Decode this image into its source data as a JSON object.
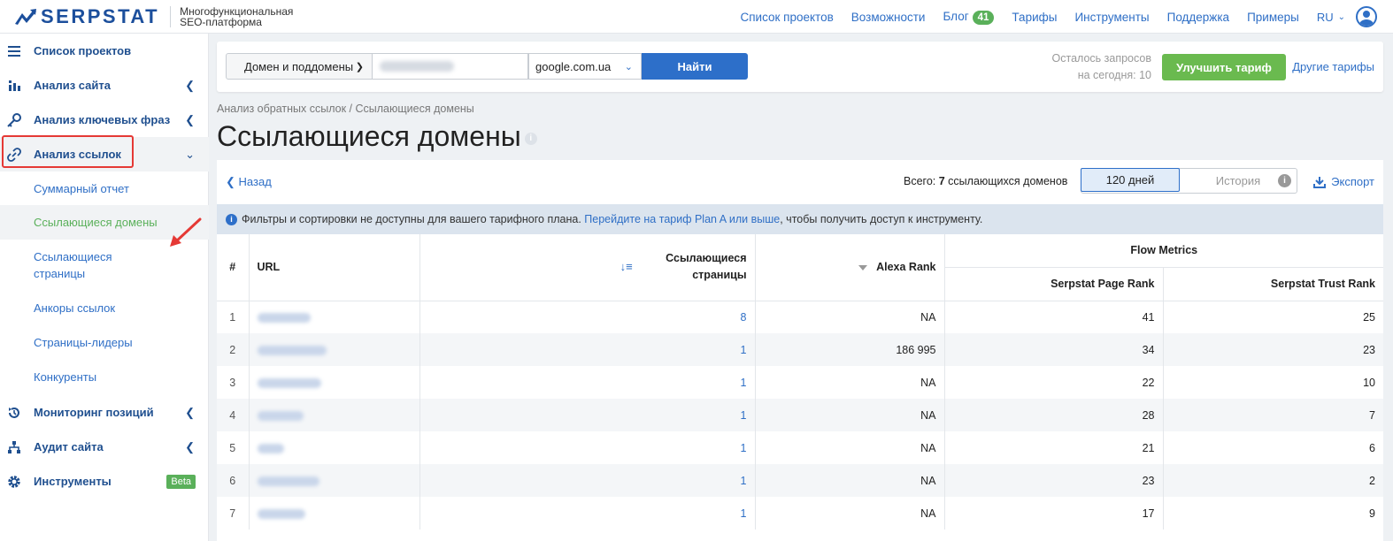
{
  "header": {
    "logo_text": "SERPSTAT",
    "logo_subtitle_1": "Многофункциональная",
    "logo_subtitle_2": "SEO-платформа",
    "nav": {
      "projects": "Список проектов",
      "features": "Возможности",
      "blog": "Блог",
      "blog_count": "41",
      "pricing": "Тарифы",
      "tools": "Инструменты",
      "support": "Поддержка",
      "examples": "Примеры"
    },
    "language": "RU"
  },
  "sidebar": {
    "items": {
      "projects": "Список проектов",
      "site_analysis": "Анализ сайта",
      "keyword_analysis": "Анализ ключевых фраз",
      "link_analysis": "Анализ ссылок",
      "position_monitoring": "Мониторинг позиций",
      "site_audit": "Аудит сайта",
      "tools": "Инструменты",
      "tools_badge": "Beta"
    },
    "sub_items": {
      "summary": "Суммарный отчет",
      "referring_domains": "Ссылающиеся домены",
      "referring_pages_1": "Ссылающиеся",
      "referring_pages_2": "страницы",
      "anchors": "Анкоры ссылок",
      "top_pages": "Страницы-лидеры",
      "competitors": "Конкуренты"
    }
  },
  "search": {
    "type_label": "Домен и поддомены",
    "database": "google.com.ua",
    "find_button": "Найти",
    "remaining_1": "Осталось запросов",
    "remaining_2": "на сегодня: 10",
    "upgrade_button": "Улучшить тариф",
    "other_tariffs": "Другие тарифы"
  },
  "page": {
    "breadcrumb": "Анализ обратных ссылок / Ссылающиеся домены",
    "title": "Ссылающиеся домены"
  },
  "toolbar": {
    "back": "Назад",
    "total_prefix": "Всего:",
    "total_count": "7",
    "total_suffix": "ссылающихся доменов",
    "period_active": "120 дней",
    "period_history": "История",
    "export": "Экспорт"
  },
  "notice": {
    "text_before": "Фильтры и сортировки не доступны для вашего тарифного плана.",
    "link": "Перейдите на тариф Plan A или выше",
    "text_after": ", чтобы получить доступ к инструменту."
  },
  "table": {
    "headers": {
      "num": "#",
      "url": "URL",
      "ref_pages_1": "Ссылающиеся",
      "ref_pages_2": "страницы",
      "alexa": "Alexa Rank",
      "flow_metrics": "Flow Metrics",
      "page_rank": "Serpstat Page Rank",
      "trust_rank": "Serpstat Trust Rank"
    },
    "rows": [
      {
        "num": "1",
        "ref": "8",
        "alexa": "NA",
        "page_rank": "41",
        "trust_rank": "25"
      },
      {
        "num": "2",
        "ref": "1",
        "alexa": "186 995",
        "page_rank": "34",
        "trust_rank": "23"
      },
      {
        "num": "3",
        "ref": "1",
        "alexa": "NA",
        "page_rank": "22",
        "trust_rank": "10"
      },
      {
        "num": "4",
        "ref": "1",
        "alexa": "NA",
        "page_rank": "28",
        "trust_rank": "7"
      },
      {
        "num": "5",
        "ref": "1",
        "alexa": "NA",
        "page_rank": "21",
        "trust_rank": "6"
      },
      {
        "num": "6",
        "ref": "1",
        "alexa": "NA",
        "page_rank": "23",
        "trust_rank": "2"
      },
      {
        "num": "7",
        "ref": "1",
        "alexa": "NA",
        "page_rank": "17",
        "trust_rank": "9"
      }
    ]
  }
}
